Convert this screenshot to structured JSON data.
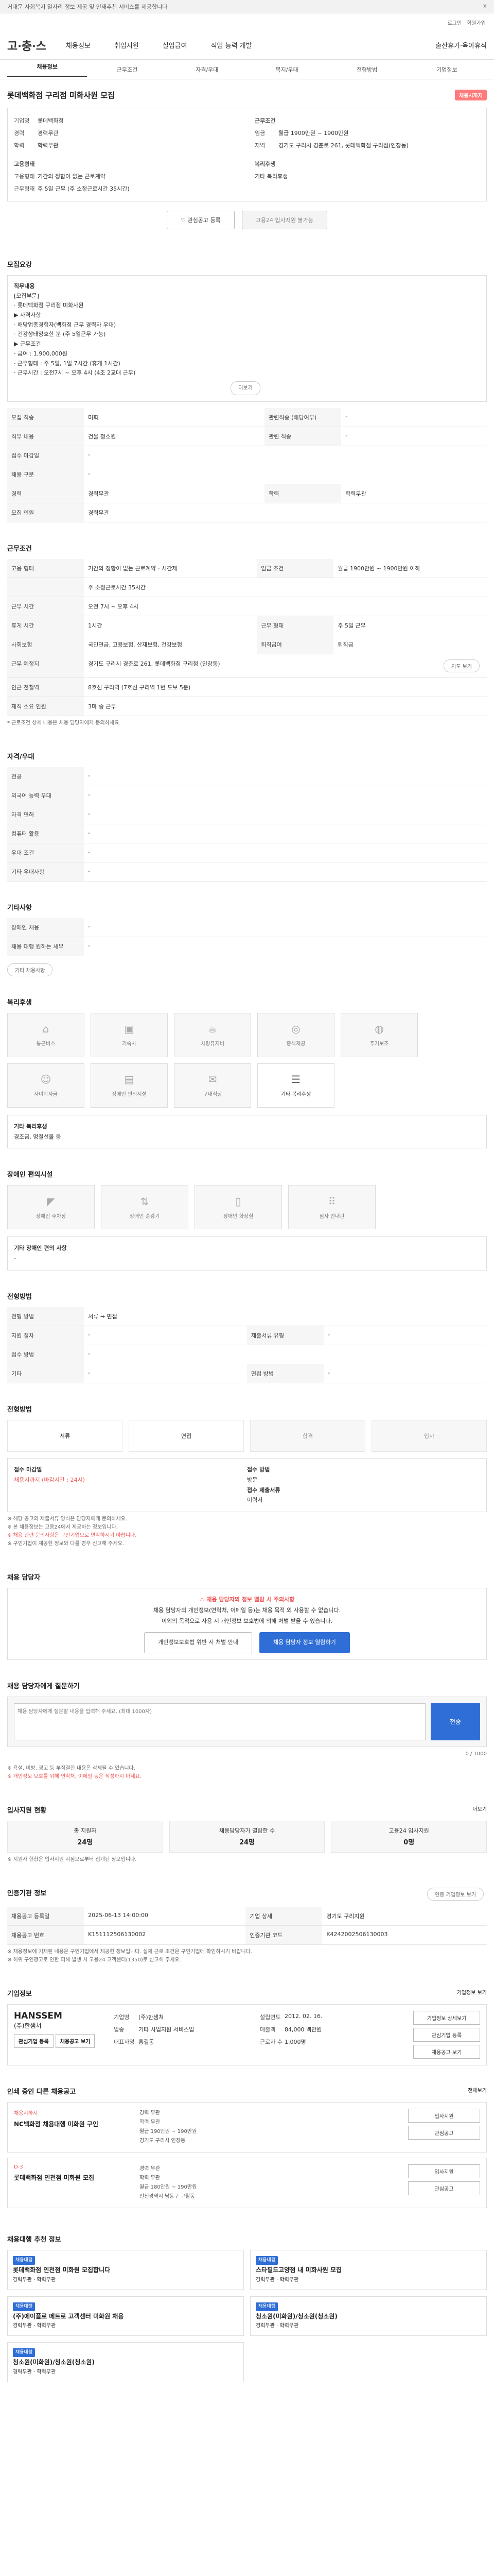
{
  "notice": {
    "text": "거대문 사회복지 일자리 정보 제공 및 인재추천 서비스를 제공합니다",
    "close": "X"
  },
  "top": {
    "links": [
      "로그인",
      "회원가입"
    ]
  },
  "brand": {
    "logo": "고·충·스",
    "menu": [
      "채용정보",
      "취업지원",
      "실업급여",
      "직업 능력 개발",
      "출산휴가·육아휴직"
    ]
  },
  "tabs": [
    "채용정보",
    "근무조건",
    "자격/우대",
    "복지/우대",
    "전형방법",
    "기업정보"
  ],
  "job": {
    "title": "롯데백화점 구리점 미화사원 모집",
    "badge": "채용시까지",
    "left": [
      {
        "k": "기업명",
        "v": "롯데백화점"
      },
      {
        "k": "경력",
        "v": "경력무관"
      },
      {
        "k": "학력",
        "v": "학력무관"
      }
    ],
    "right_h": "근무조건",
    "right": [
      {
        "k": "임금",
        "v": "월급 1900만원 ~ 1900만원"
      },
      {
        "k": "지역",
        "v": "경기도 구리시 경춘로 261, 롯데백화점 구리점(인창동)"
      }
    ],
    "left2_h": "고용형태",
    "left2": [
      {
        "k": "고용형태",
        "v": "기간의 정함이 없는 근로계약"
      },
      {
        "k": "근무형태",
        "v": "주 5일 근무 (주 소정근로시간 35시간)"
      }
    ],
    "right2_h": "복리후생",
    "right2": [
      {
        "k": "",
        "v": "기타 복리후생"
      }
    ]
  },
  "actions": {
    "scrap": "관심공고 등록",
    "apply": "고용24 입사지원 불가능"
  },
  "sec_recruit": {
    "title": "모집요강",
    "desc_h": "직무내용",
    "desc": [
      "[모집부문]",
      "  · 롯데백화점 구리점 미화사원",
      "  ▶ 자격사항",
      "  · 해당업종경험자(백화점 근무 경력자 우대)",
      "  · 건강상태양호한 분 (주 5일근무 가능)",
      "  ▶ 근무조건",
      "  · 급여 : 1,900,000원",
      "  · 근무형태 : 주 5일, 1일 7시간 (휴게 1시간)",
      "  · 근무시간 : 오전7시 ~ 오후 4시 (4조 2교대 근무)"
    ],
    "more": "더보기",
    "rows": [
      [
        {
          "k": "모집 직종",
          "v": "미화"
        },
        {
          "k": "관련직종 (해당여부)",
          "v": "-"
        }
      ],
      [
        {
          "k": "직무 내용",
          "v": "건물 청소원"
        },
        {
          "k": "관련 직종",
          "v": "-"
        }
      ],
      [
        {
          "k": "접수 마감일",
          "v": "-"
        },
        {
          "k": "",
          "v": ""
        }
      ],
      [
        {
          "k": "채용 구분",
          "v": "-"
        },
        {
          "k": "",
          "v": ""
        }
      ],
      [
        {
          "k": "경력",
          "v": "경력무관"
        },
        {
          "k": "학력",
          "v": "학력무관"
        }
      ],
      [
        {
          "k": "모집 인원",
          "v": "경력무관"
        },
        {
          "k": "",
          "v": ""
        }
      ]
    ]
  },
  "sec_cond": {
    "title": "근무조건",
    "rows": [
      [
        {
          "k": "고용 형태",
          "v": "기간의 정함이 없는 근로계약 - 시간제"
        },
        {
          "k": "임금 조건",
          "v": "월급 1900만원 ~ 1900만원 이하"
        }
      ],
      [
        {
          "k": "",
          "v": "주 소정근로시간 35시간"
        },
        {
          "k": "",
          "v": ""
        }
      ],
      [
        {
          "k": "근무 시간",
          "v": "오전 7시 ~ 오후 4시"
        },
        {
          "k": "",
          "v": ""
        }
      ],
      [
        {
          "k": "휴게 시간",
          "v": "1시간"
        },
        {
          "k": "근무 형태",
          "v": "주 5일 근무"
        }
      ],
      [
        {
          "k": "사회보험",
          "v": "국민연금, 고용보험, 산재보험, 건강보험"
        },
        {
          "k": "퇴직급여",
          "v": "퇴직금"
        }
      ],
      [
        {
          "k": "근무 예정지",
          "v": "경기도 구리시 경춘로 261, 롯데백화점 구리점 (인창동)"
        },
        {
          "k": "",
          "v": ""
        }
      ],
      [
        {
          "k": "인근 전철역",
          "v": "8호선 구리역 (7호선 구리역 1번 도보 5분)"
        },
        {
          "k": "",
          "v": ""
        }
      ],
      [
        {
          "k": "재직 소요 인원",
          "v": "3마 중 근무"
        },
        {
          "k": "",
          "v": ""
        }
      ]
    ],
    "map_btn": "지도 보기",
    "note": "* 근로조건 상세 내용은 채용 담당자에게 문의하세요."
  },
  "sec_qual": {
    "title": "자격/우대",
    "rows": [
      {
        "k": "전공",
        "v": "-"
      },
      {
        "k": "외국어 능력 우대",
        "v": "-"
      },
      {
        "k": "자격 면허",
        "v": "-"
      },
      {
        "k": "컴퓨터 활용",
        "v": "-"
      },
      {
        "k": "우대 조건",
        "v": "-"
      },
      {
        "k": "기타 우대사항",
        "v": "-"
      }
    ]
  },
  "sec_etc": {
    "title": "기타사항",
    "rows": [
      {
        "k": "장애인 채용",
        "v": "-"
      },
      {
        "k": "채용 대행 원하는 세부",
        "v": "-"
      }
    ],
    "pill": "기타 채용사항"
  },
  "sec_welfare": {
    "title": "복리후생",
    "items": [
      {
        "icon": "home-icon",
        "label": "통근버스"
      },
      {
        "icon": "bus-icon",
        "label": "기숙사"
      },
      {
        "icon": "cup-icon",
        "label": "차량유지비"
      },
      {
        "icon": "meal-icon",
        "label": "중식제공"
      },
      {
        "icon": "coin-icon",
        "label": "주거보조"
      },
      {
        "icon": "child-icon",
        "label": "자녀학자금"
      },
      {
        "icon": "chart-icon",
        "label": "장애인 편의시설"
      },
      {
        "icon": "gift-icon",
        "label": "구내식당"
      },
      {
        "icon": "note-icon",
        "label": "기타 복리후생"
      }
    ],
    "extra_h": "기타 복리후생",
    "extra": "경조금, 명절선물 등"
  },
  "sec_disabled": {
    "title": "장애인 편의시설",
    "items": [
      {
        "icon": "ramp-icon",
        "label": "장애인 주차장"
      },
      {
        "icon": "lift-icon",
        "label": "장애인 승강기"
      },
      {
        "icon": "door-icon",
        "label": "장애인 화장실"
      },
      {
        "icon": "sign-icon",
        "label": "점자 안내판"
      }
    ],
    "extra_h": "기타 장애인 편의 사항",
    "extra": "-"
  },
  "sec_method": {
    "title": "전형방법",
    "rows": [
      [
        {
          "k": "전형 방법",
          "v": "서류 → 면접"
        }
      ],
      [
        {
          "k": "지원 절차",
          "v": "-"
        },
        {
          "k": "제출서류 유형",
          "v": "-"
        }
      ],
      [
        {
          "k": "접수 방법",
          "v": "-"
        },
        {
          "k": "",
          "v": ""
        }
      ],
      [
        {
          "k": "기타",
          "v": "-"
        },
        {
          "k": "면접 방법",
          "v": "-"
        }
      ]
    ]
  },
  "sec_apply": {
    "title": "전형방법",
    "steps": [
      "서류",
      "면접",
      "합격",
      "입사"
    ],
    "left_h": "접수 마감일",
    "left_v": "채용시까지 (마감시간 : 24시)",
    "right": [
      {
        "k": "접수 방법",
        "v": "방문"
      },
      {
        "k": "접수 제출서류",
        "v": "이력서"
      }
    ],
    "notes": [
      "※ 해당 공고의 제출서류 양식은 담당자에게 문의하세요.",
      "※ 본 채용정보는 고용24에서 제공하는 정보입니다.",
      "※ 채용 관련 문의사항은 구인기업으로 연락하시기 바랍니다.",
      "※ 구인기업이 제공한 정보와 다를 경우 신고해 주세요."
    ]
  },
  "sec_contact": {
    "title": "채용 담당자",
    "alert": "채용 담당자의 정보 열람 시 주의사항",
    "desc": [
      "채용 담당자의 개인정보(연락처, 이메일 등)는 채용 목적 외 사용할 수 없습니다.",
      "이외의 목적으로 사용 시 개인정보 보호법에 의해 처벌 받을 수 있습니다."
    ],
    "btn1": "개인정보보호법 위반 시 처벌 안내",
    "btn2": "채용 담당자 정보 열람하기"
  },
  "sec_chat": {
    "title": "채용 담당자에게 질문하기",
    "placeholder": "채용 담당자에게 질문할 내용을 입력해 주세요. (최대 1000자)",
    "send": "전송",
    "count": "0 / 1000",
    "notes": [
      "※ 욕설, 비방, 광고 등 부적절한 내용은 삭제될 수 있습니다.",
      "※ 개인정보 보호를 위해 연락처, 이메일 등은 작성하지 마세요."
    ]
  },
  "sec_stats": {
    "title": "입사지원 현황",
    "more": "더보기",
    "items": [
      {
        "label": "총 지원자",
        "v": "24명"
      },
      {
        "label": "채용담당자가 열람한 수",
        "v": "24명"
      },
      {
        "label": "고용24 입사지원",
        "v": "0명"
      }
    ],
    "note": "※ 지원자 현황은 입사지원 시점으로부터 집계된 정보입니다."
  },
  "sec_info": {
    "title": "인증기관 정보",
    "btn": "인증 기업정보 보기",
    "rows": [
      [
        {
          "k": "채용공고 등록일",
          "v": "2025-06-13 14:00:00"
        },
        {
          "k": "기업 상세",
          "v": "경기도 구리지원"
        }
      ],
      [
        {
          "k": "채용공고 번호",
          "v": "K151112506130002"
        },
        {
          "k": "인증기관 코드",
          "v": "K4242002506130003"
        }
      ]
    ],
    "notes": [
      "※ 채용정보에 기재된 내용은 구인기업에서 제공한 정보입니다. 실제 근로 조건은 구인기업에 확인하시기 바랍니다.",
      "※ 허위 구인광고로 인한 피해 발생 시 고용24 고객센터(1350)로 신고해 주세요."
    ]
  },
  "sec_company": {
    "title": "기업정보",
    "more": "기업정보 보기",
    "logo": "HANSSEM",
    "sub": "(주)한샘쳐",
    "btns": [
      "관심기업 등록",
      "채용공고 보기"
    ],
    "info": [
      [
        {
          "k": "기업명",
          "v": "(주)한샘쳐"
        },
        {
          "k": "업종",
          "v": "기타 사업지원 서비스업"
        },
        {
          "k": "대표자명",
          "v": "홍길동"
        }
      ],
      [
        {
          "k": "설립연도",
          "v": "2012. 02. 16."
        },
        {
          "k": "매출액",
          "v": "84,000 백만원"
        },
        {
          "k": "근로자 수",
          "v": "1,000명"
        }
      ]
    ],
    "detail": "기업정보 상세보기",
    "right": [
      "관심기업 등록",
      "채용공고 보기"
    ]
  },
  "sec_jobs": {
    "title": "인쇄 중인 다른 채용공고",
    "more": "전체보기",
    "items": [
      {
        "tag": "채용시까지",
        "title": "NC백화점 채용대행 미화원 구인",
        "meta": [
          "경력 무관",
          "학력 무관",
          "월급 190만원 ~ 190만원",
          "경기도 구리시 인창동"
        ],
        "btns": [
          "입사지원",
          "관심공고"
        ]
      },
      {
        "tag": "D-3",
        "title": "롯데백화점 인천점 미화원 모집",
        "meta": [
          "경력 무관",
          "학력 무관",
          "월급 180만원 ~ 190만원",
          "인천광역시 남동구 구월동"
        ],
        "btns": [
          "입사지원",
          "관심공고"
        ]
      }
    ]
  },
  "sec_similar": {
    "title": "채용대행 추천 정보",
    "items": [
      {
        "tag": "채용대행",
        "title": "롯데백화점 인천점 미화원 모집합니다",
        "a": "경력무관",
        "b": "학력무관"
      },
      {
        "tag": "채용대행",
        "title": "스타필드고양점 내 미화사원 모집",
        "a": "경력무관",
        "b": "학력무관"
      },
      {
        "tag": "채용대행",
        "title": "(주)에이플로 메트로 고객센터 미화원 채용",
        "a": "경력무관",
        "b": "학력무관"
      },
      {
        "tag": "채용대행",
        "title": "청소원(미화원)/청소원(청소원)",
        "a": "경력무관",
        "b": "학력무관"
      },
      {
        "tag": "채용대행",
        "title": "청소원(미화원)/청소원(청소원)",
        "a": "경력무관",
        "b": "학력무관"
      }
    ]
  }
}
